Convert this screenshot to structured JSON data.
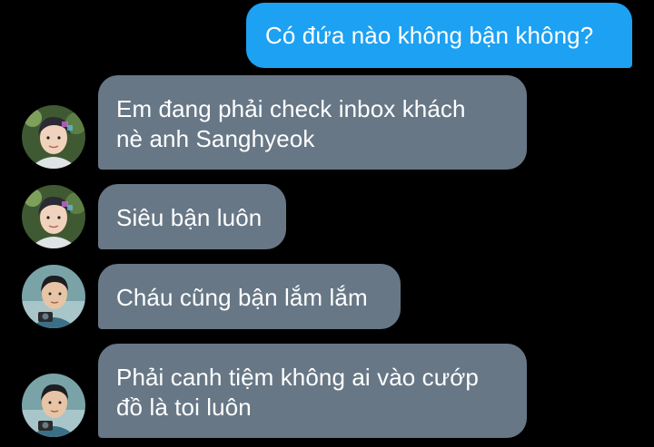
{
  "messages": [
    {
      "direction": "outgoing",
      "lines": [
        "Có đứa nào không bận không?"
      ]
    },
    {
      "direction": "incoming",
      "avatar_icon": "person-a-avatar-icon",
      "lines": [
        "Em đang phải check inbox khách",
        "nè anh Sanghyeok"
      ]
    },
    {
      "direction": "incoming",
      "avatar_icon": "person-a-avatar-icon",
      "lines": [
        "Siêu bận luôn"
      ]
    },
    {
      "direction": "incoming",
      "avatar_icon": "person-b-avatar-icon",
      "lines": [
        "Cháu cũng bận lắm lắm"
      ]
    },
    {
      "direction": "incoming",
      "avatar_icon": "person-b-avatar-icon",
      "lines": [
        "Phải canh tiệm không ai vào cướp",
        "đồ là toi luôn"
      ]
    }
  ],
  "colors": {
    "background": "#000000",
    "outgoing_bubble": "#1da1f2",
    "incoming_bubble": "#677786",
    "text": "#ffffff"
  }
}
